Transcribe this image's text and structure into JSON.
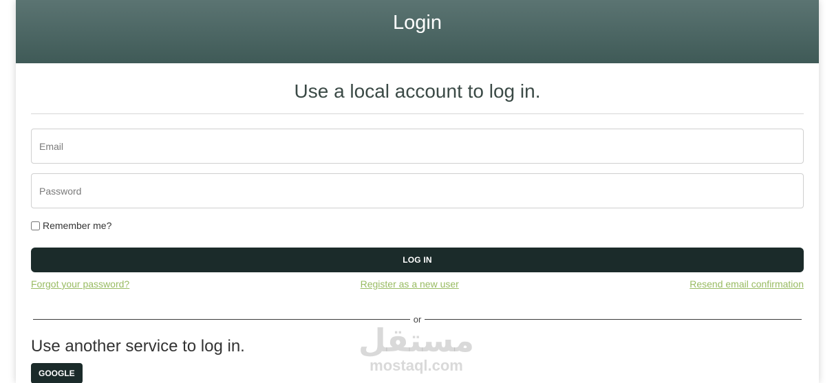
{
  "header": {
    "title": "Login"
  },
  "local_login": {
    "title": "Use a local account to log in.",
    "email_placeholder": "Email",
    "password_placeholder": "Password",
    "remember_label": "Remember me?",
    "remember_checked": false,
    "login_button_label": "LOG IN"
  },
  "links": {
    "forgot_password": "Forgot your password?",
    "register": "Register as a new user",
    "resend_confirmation": "Resend email confirmation"
  },
  "separator": {
    "label": "or"
  },
  "external_login": {
    "title": "Use another service to log in.",
    "google_button_label": "GOOGLE"
  },
  "watermark": {
    "arabic": "مستقل",
    "latin": "mostaql.com"
  },
  "colors": {
    "header_gradient_top": "#5b7472",
    "header_gradient_bottom": "#3f5a57",
    "button_bg": "#1b2b2a",
    "link": "#98bb62"
  }
}
